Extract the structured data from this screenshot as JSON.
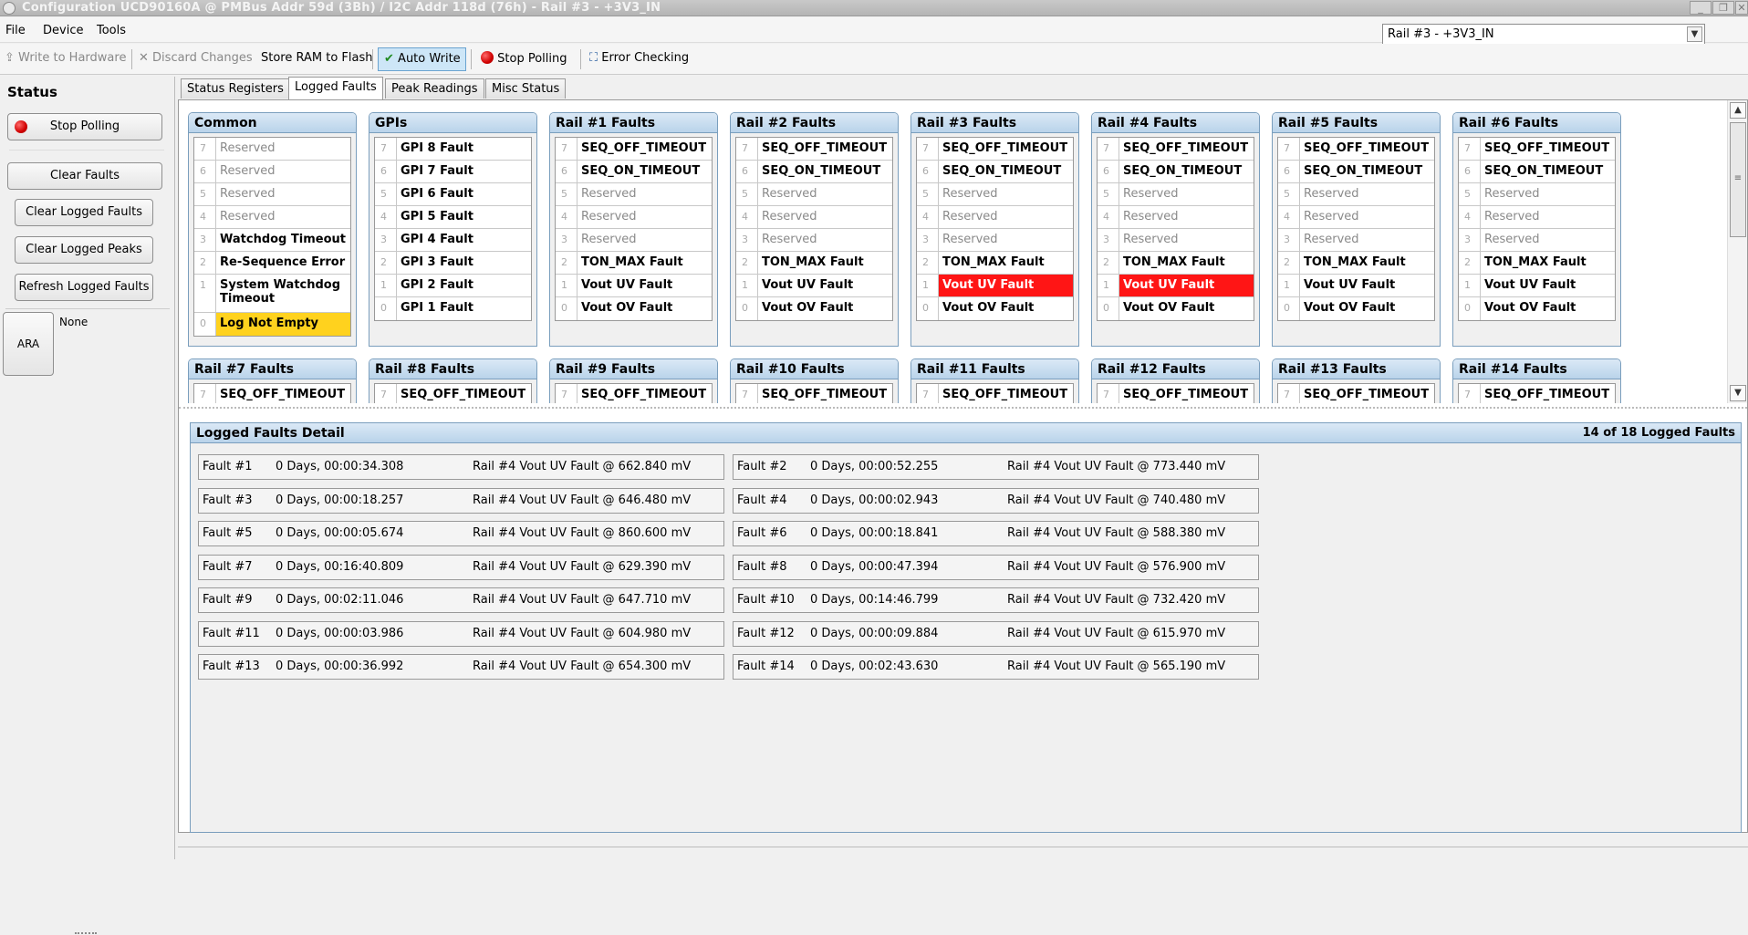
{
  "window": {
    "title": "Configuration UCD90160A @ PMBus Addr 59d (3Bh) / I2C Addr 118d (76h) - Rail #3 - +3V3_IN"
  },
  "menu": [
    "File",
    "Device",
    "Tools"
  ],
  "rail_select": {
    "value": "Rail #3 - +3V3_IN"
  },
  "toolbar": {
    "write": "Write to Hardware",
    "discard": "Discard Changes",
    "store": "Store RAM to Flash",
    "autowrite": "Auto Write",
    "stop": "Stop Polling",
    "error": "Error Checking"
  },
  "left": {
    "title": "Status",
    "stop": "Stop Polling",
    "clear": "Clear Faults",
    "clear_logged": "Clear Logged Faults",
    "clear_peaks": "Clear Logged Peaks",
    "refresh": "Refresh Logged Faults",
    "ara": "ARA",
    "ara_value": "None"
  },
  "tabs": [
    "Status Registers",
    "Logged Faults",
    "Peak Readings",
    "Misc Status"
  ],
  "active_tab": "Logged Faults",
  "panels": [
    {
      "title": "Common",
      "bits": [
        {
          "n": "7",
          "label": "Reserved",
          "state": "res"
        },
        {
          "n": "6",
          "label": "Reserved",
          "state": "res"
        },
        {
          "n": "5",
          "label": "Reserved",
          "state": "res"
        },
        {
          "n": "4",
          "label": "Reserved",
          "state": "res"
        },
        {
          "n": "3",
          "label": "Watchdog Timeout",
          "state": "act"
        },
        {
          "n": "2",
          "label": "Re-Sequence Error",
          "state": "act"
        },
        {
          "n": "1",
          "label": "System Watchdog Timeout",
          "state": "act"
        },
        {
          "n": "0",
          "label": "Log Not Empty",
          "state": "yel"
        }
      ]
    },
    {
      "title": "GPIs",
      "bits": [
        {
          "n": "7",
          "label": "GPI 8 Fault",
          "state": "act"
        },
        {
          "n": "6",
          "label": "GPI 7 Fault",
          "state": "act"
        },
        {
          "n": "5",
          "label": "GPI 6 Fault",
          "state": "act"
        },
        {
          "n": "4",
          "label": "GPI 5 Fault",
          "state": "act"
        },
        {
          "n": "3",
          "label": "GPI 4 Fault",
          "state": "act"
        },
        {
          "n": "2",
          "label": "GPI 3 Fault",
          "state": "act"
        },
        {
          "n": "1",
          "label": "GPI 2 Fault",
          "state": "act"
        },
        {
          "n": "0",
          "label": "GPI 1 Fault",
          "state": "act"
        }
      ]
    },
    {
      "title": "Rail #1 Faults",
      "bits": [
        {
          "n": "7",
          "label": "SEQ_OFF_TIMEOUT",
          "state": "act"
        },
        {
          "n": "6",
          "label": "SEQ_ON_TIMEOUT",
          "state": "act"
        },
        {
          "n": "5",
          "label": "Reserved",
          "state": "res"
        },
        {
          "n": "4",
          "label": "Reserved",
          "state": "res"
        },
        {
          "n": "3",
          "label": "Reserved",
          "state": "res"
        },
        {
          "n": "2",
          "label": "TON_MAX Fault",
          "state": "act"
        },
        {
          "n": "1",
          "label": "Vout UV Fault",
          "state": "act"
        },
        {
          "n": "0",
          "label": "Vout OV Fault",
          "state": "act"
        }
      ]
    },
    {
      "title": "Rail #2 Faults",
      "bits": [
        {
          "n": "7",
          "label": "SEQ_OFF_TIMEOUT",
          "state": "act"
        },
        {
          "n": "6",
          "label": "SEQ_ON_TIMEOUT",
          "state": "act"
        },
        {
          "n": "5",
          "label": "Reserved",
          "state": "res"
        },
        {
          "n": "4",
          "label": "Reserved",
          "state": "res"
        },
        {
          "n": "3",
          "label": "Reserved",
          "state": "res"
        },
        {
          "n": "2",
          "label": "TON_MAX Fault",
          "state": "act"
        },
        {
          "n": "1",
          "label": "Vout UV Fault",
          "state": "act"
        },
        {
          "n": "0",
          "label": "Vout OV Fault",
          "state": "act"
        }
      ]
    },
    {
      "title": "Rail #3 Faults",
      "bits": [
        {
          "n": "7",
          "label": "SEQ_OFF_TIMEOUT",
          "state": "act"
        },
        {
          "n": "6",
          "label": "SEQ_ON_TIMEOUT",
          "state": "act"
        },
        {
          "n": "5",
          "label": "Reserved",
          "state": "res"
        },
        {
          "n": "4",
          "label": "Reserved",
          "state": "res"
        },
        {
          "n": "3",
          "label": "Reserved",
          "state": "res"
        },
        {
          "n": "2",
          "label": "TON_MAX Fault",
          "state": "act"
        },
        {
          "n": "1",
          "label": "Vout UV Fault",
          "state": "red"
        },
        {
          "n": "0",
          "label": "Vout OV Fault",
          "state": "act"
        }
      ]
    },
    {
      "title": "Rail #4 Faults",
      "bits": [
        {
          "n": "7",
          "label": "SEQ_OFF_TIMEOUT",
          "state": "act"
        },
        {
          "n": "6",
          "label": "SEQ_ON_TIMEOUT",
          "state": "act"
        },
        {
          "n": "5",
          "label": "Reserved",
          "state": "res"
        },
        {
          "n": "4",
          "label": "Reserved",
          "state": "res"
        },
        {
          "n": "3",
          "label": "Reserved",
          "state": "res"
        },
        {
          "n": "2",
          "label": "TON_MAX Fault",
          "state": "act"
        },
        {
          "n": "1",
          "label": "Vout UV Fault",
          "state": "red"
        },
        {
          "n": "0",
          "label": "Vout OV Fault",
          "state": "act"
        }
      ]
    },
    {
      "title": "Rail #5 Faults",
      "bits": [
        {
          "n": "7",
          "label": "SEQ_OFF_TIMEOUT",
          "state": "act"
        },
        {
          "n": "6",
          "label": "SEQ_ON_TIMEOUT",
          "state": "act"
        },
        {
          "n": "5",
          "label": "Reserved",
          "state": "res"
        },
        {
          "n": "4",
          "label": "Reserved",
          "state": "res"
        },
        {
          "n": "3",
          "label": "Reserved",
          "state": "res"
        },
        {
          "n": "2",
          "label": "TON_MAX Fault",
          "state": "act"
        },
        {
          "n": "1",
          "label": "Vout UV Fault",
          "state": "act"
        },
        {
          "n": "0",
          "label": "Vout OV Fault",
          "state": "act"
        }
      ]
    },
    {
      "title": "Rail #6 Faults",
      "bits": [
        {
          "n": "7",
          "label": "SEQ_OFF_TIMEOUT",
          "state": "act"
        },
        {
          "n": "6",
          "label": "SEQ_ON_TIMEOUT",
          "state": "act"
        },
        {
          "n": "5",
          "label": "Reserved",
          "state": "res"
        },
        {
          "n": "4",
          "label": "Reserved",
          "state": "res"
        },
        {
          "n": "3",
          "label": "Reserved",
          "state": "res"
        },
        {
          "n": "2",
          "label": "TON_MAX Fault",
          "state": "act"
        },
        {
          "n": "1",
          "label": "Vout UV Fault",
          "state": "act"
        },
        {
          "n": "0",
          "label": "Vout OV Fault",
          "state": "act"
        }
      ]
    },
    {
      "title": "Rail #7 Faults",
      "bits": [
        {
          "n": "7",
          "label": "SEQ_OFF_TIMEOUT",
          "state": "act"
        }
      ]
    },
    {
      "title": "Rail #8 Faults",
      "bits": [
        {
          "n": "7",
          "label": "SEQ_OFF_TIMEOUT",
          "state": "act"
        }
      ]
    },
    {
      "title": "Rail #9 Faults",
      "bits": [
        {
          "n": "7",
          "label": "SEQ_OFF_TIMEOUT",
          "state": "act"
        }
      ]
    },
    {
      "title": "Rail #10 Faults",
      "bits": [
        {
          "n": "7",
          "label": "SEQ_OFF_TIMEOUT",
          "state": "act"
        }
      ]
    },
    {
      "title": "Rail #11 Faults",
      "bits": [
        {
          "n": "7",
          "label": "SEQ_OFF_TIMEOUT",
          "state": "act"
        }
      ]
    },
    {
      "title": "Rail #12 Faults",
      "bits": [
        {
          "n": "7",
          "label": "SEQ_OFF_TIMEOUT",
          "state": "act"
        }
      ]
    },
    {
      "title": "Rail #13 Faults",
      "bits": [
        {
          "n": "7",
          "label": "SEQ_OFF_TIMEOUT",
          "state": "act"
        }
      ]
    },
    {
      "title": "Rail #14 Faults",
      "bits": [
        {
          "n": "7",
          "label": "SEQ_OFF_TIMEOUT",
          "state": "act"
        }
      ]
    }
  ],
  "detail": {
    "title": "Logged Faults Detail",
    "count": "14 of 18 Logged Faults",
    "faults": [
      {
        "id": "Fault #1",
        "time": "0 Days, 00:00:34.308",
        "desc": "Rail #4 Vout UV Fault @ 662.840 mV"
      },
      {
        "id": "Fault #2",
        "time": "0 Days, 00:00:52.255",
        "desc": "Rail #4 Vout UV Fault @ 773.440 mV"
      },
      {
        "id": "Fault #3",
        "time": "0 Days, 00:00:18.257",
        "desc": "Rail #4 Vout UV Fault @ 646.480 mV"
      },
      {
        "id": "Fault #4",
        "time": "0 Days, 00:00:02.943",
        "desc": "Rail #4 Vout UV Fault @ 740.480 mV"
      },
      {
        "id": "Fault #5",
        "time": "0 Days, 00:00:05.674",
        "desc": "Rail #4 Vout UV Fault @ 860.600 mV"
      },
      {
        "id": "Fault #6",
        "time": "0 Days, 00:00:18.841",
        "desc": "Rail #4 Vout UV Fault @ 588.380 mV"
      },
      {
        "id": "Fault #7",
        "time": "0 Days, 00:16:40.809",
        "desc": "Rail #4 Vout UV Fault @ 629.390 mV"
      },
      {
        "id": "Fault #8",
        "time": "0 Days, 00:00:47.394",
        "desc": "Rail #4 Vout UV Fault @ 576.900 mV"
      },
      {
        "id": "Fault #9",
        "time": "0 Days, 00:02:11.046",
        "desc": "Rail #4 Vout UV Fault @ 647.710 mV"
      },
      {
        "id": "Fault #10",
        "time": "0 Days, 00:14:46.799",
        "desc": "Rail #4 Vout UV Fault @ 732.420 mV"
      },
      {
        "id": "Fault #11",
        "time": "0 Days, 00:00:03.986",
        "desc": "Rail #4 Vout UV Fault @ 604.980 mV"
      },
      {
        "id": "Fault #12",
        "time": "0 Days, 00:00:09.884",
        "desc": "Rail #4 Vout UV Fault @ 615.970 mV"
      },
      {
        "id": "Fault #13",
        "time": "0 Days, 00:00:36.992",
        "desc": "Rail #4 Vout UV Fault @ 654.300 mV"
      },
      {
        "id": "Fault #14",
        "time": "0 Days, 00:02:43.630",
        "desc": "Rail #4 Vout UV Fault @ 565.190 mV"
      }
    ]
  }
}
